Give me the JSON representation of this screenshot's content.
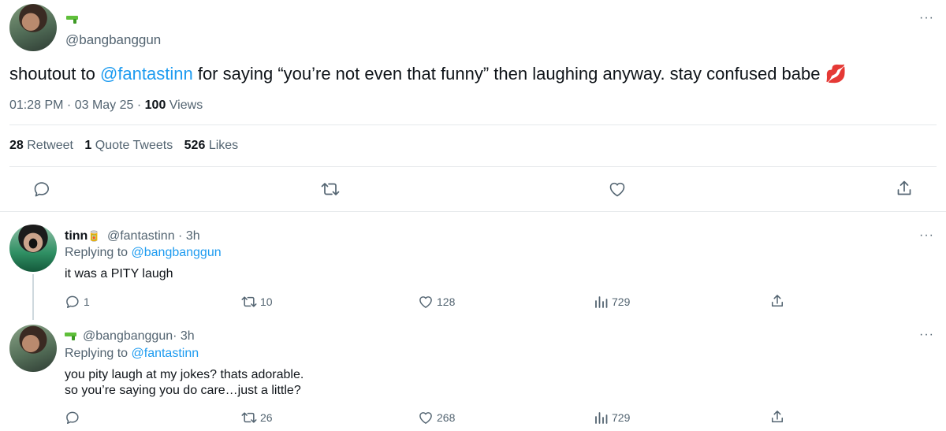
{
  "main_tweet": {
    "handle": "@bangbanggun",
    "text_before": "shoutout to ",
    "mention": "@fantastinn",
    "text_after": " for saying “you’re not even that funny” then laughing anyway. stay confused babe 💋",
    "time": "01:28 PM",
    "sep": " · ",
    "date": "03 May 25",
    "sep2": " · ",
    "views_count": "100",
    "views_label": "Views",
    "retweets_count": "28",
    "retweets_label": "Retweet",
    "quotes_count": "1",
    "quotes_label": "Quote Tweets",
    "likes_count": "526",
    "likes_label": "Likes",
    "more": "···"
  },
  "replies": [
    {
      "name": "tinn",
      "name_emoji": "🥫",
      "handle": "@fantastinn",
      "age": " · 3h",
      "replying_prefix": "Replying to ",
      "replying_to": "@bangbanggun",
      "text_line1": "it was a PITY laugh",
      "text_line2": "",
      "replies": "1",
      "retweets": "10",
      "likes": "128",
      "views": "729",
      "more": "···"
    },
    {
      "name": "",
      "handle": "@bangbanggun",
      "age": " · 3h",
      "replying_prefix": "Replying to ",
      "replying_to": "@fantastinn",
      "text_line1": "you pity laugh at my jokes? thats adorable.",
      "text_line2": "so you’re saying you do care…just a little?",
      "replies": "",
      "retweets": "26",
      "likes": "268",
      "views": "729",
      "more": "···"
    }
  ],
  "icons": {
    "reply": "reply-icon",
    "retweet": "retweet-icon",
    "like": "heart-icon",
    "views": "views-chart-icon",
    "share": "share-icon",
    "gun": "water-gun-emoji-icon",
    "kiss": "kiss-mark-emoji-icon"
  },
  "colors": {
    "link": "#1d9bf0",
    "muted": "#536471",
    "text": "#0f1419",
    "divider": "#e6e9eb"
  }
}
